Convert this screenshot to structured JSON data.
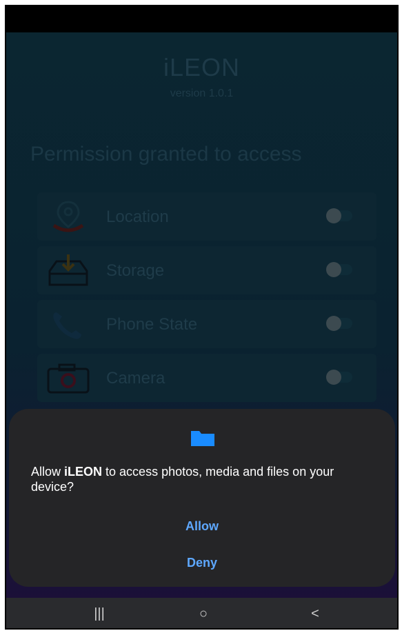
{
  "app": {
    "title": "iLEON",
    "version": "version 1.0.1",
    "permission_heading": "Permission granted to access",
    "permissions": [
      {
        "label": "Location",
        "icon": "location-pin-icon",
        "enabled": false
      },
      {
        "label": "Storage",
        "icon": "storage-download-icon",
        "enabled": false
      },
      {
        "label": "Phone State",
        "icon": "phone-icon",
        "enabled": false
      },
      {
        "label": "Camera",
        "icon": "camera-icon",
        "enabled": false
      }
    ]
  },
  "dialog": {
    "icon": "folder-icon",
    "message_prefix": "Allow ",
    "app_name": "iLEON",
    "message_suffix": " to access photos, media and files on your device?",
    "allow_label": "Allow",
    "deny_label": "Deny",
    "accent_color": "#5ea8ff"
  },
  "navbar": {
    "recent_label": "|||",
    "home_label": "○",
    "back_label": "<"
  }
}
